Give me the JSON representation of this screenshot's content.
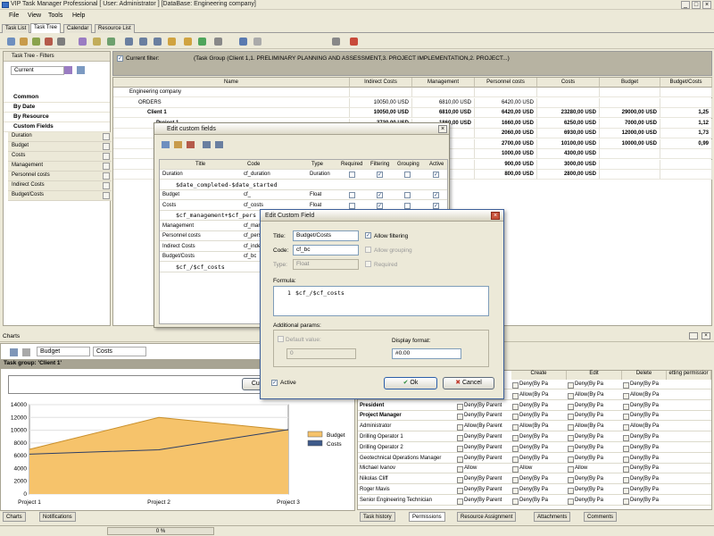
{
  "window": {
    "title": "VIP Task Manager Professional [ User: Administrator ] [DataBase: Engineering company]"
  },
  "menu": [
    "File",
    "View",
    "Tools",
    "Help"
  ],
  "tabs": [
    "Task List",
    "Task Tree",
    "Calendar",
    "Resource List"
  ],
  "filters": {
    "title": "Task Tree - Filters",
    "current": "Current",
    "groups": [
      "Common",
      "By Date",
      "By Resource",
      "Custom Fields"
    ],
    "fields": [
      "Duration",
      "Budget",
      "Costs",
      "Management",
      "Personnel costs",
      "Indirect Costs",
      "Budget/Costs"
    ]
  },
  "current_filter": {
    "label": "Current filter:",
    "text": "(Task Group  (Client 1,1. PRELIMINARY PLANNING AND ASSESSMENT,3. PROJECT IMPLEMENTATION,2. PROJECT...)"
  },
  "grid": {
    "headers": [
      "Name",
      "Indirect Costs",
      "Management",
      "Personnel costs",
      "Costs",
      "Budget",
      "Budget/Costs"
    ],
    "rows": [
      {
        "name": "Engineering company",
        "v": [
          "",
          "",
          "",
          "",
          "",
          ""
        ]
      },
      {
        "name": "ORDERS",
        "v": [
          "10050,00 USD",
          "6810,00 USD",
          "6420,00 USD",
          "",
          "",
          ""
        ]
      },
      {
        "name": "Client 1",
        "v": [
          "10050,00 USD",
          "6810,00 USD",
          "6420,00 USD",
          "23280,00 USD",
          "29000,00 USD",
          "1,25"
        ]
      },
      {
        "name": "Project 1",
        "v": [
          "3730,00 USD",
          "1860,00 USD",
          "1660,00 USD",
          "6250,00 USD",
          "7000,00 USD",
          "1,12"
        ]
      },
      {
        "name": "",
        "v": [
          "",
          "",
          "2060,00 USD",
          "6930,00 USD",
          "12000,00 USD",
          "1,73"
        ]
      },
      {
        "name": "",
        "v": [
          "",
          "",
          "2700,00 USD",
          "10100,00 USD",
          "10000,00 USD",
          "0,99"
        ]
      },
      {
        "name": "",
        "v": [
          "",
          "",
          "1000,00 USD",
          "4300,00 USD",
          "",
          ""
        ]
      },
      {
        "name": "",
        "v": [
          "",
          "",
          "900,00 USD",
          "3000,00 USD",
          "",
          ""
        ]
      },
      {
        "name": "",
        "v": [
          "",
          "",
          "800,00 USD",
          "2800,00 USD",
          "",
          ""
        ]
      }
    ]
  },
  "edit_fields": {
    "title": "Edit custom fields",
    "headers": [
      "Title",
      "Code",
      "Type",
      "Required",
      "Filtering",
      "Grouping",
      "Active"
    ],
    "rows": [
      {
        "title": "Duration",
        "code": "cf_duration",
        "type": "Duration"
      },
      {
        "formula": "$date_completed-$date_started"
      },
      {
        "title": "Budget",
        "code": "cf_",
        "type": "Float"
      },
      {
        "title": "Costs",
        "code": "cf_costs",
        "type": "Float"
      },
      {
        "formula": "$cf_management+$cf_pers"
      },
      {
        "title": "Management",
        "code": "cf_man",
        "type": ""
      },
      {
        "title": "Personnel costs",
        "code": "cf_pers",
        "type": ""
      },
      {
        "title": "Indirect Costs",
        "code": "cf_inde",
        "type": ""
      },
      {
        "title": "Budget/Costs",
        "code": "cf_bc",
        "type": ""
      },
      {
        "formula": "$cf_/$cf_costs"
      }
    ]
  },
  "edit_field": {
    "title": "Edit Custom Field",
    "title_label": "Title:",
    "title_value": "Budget/Costs",
    "code_label": "Code:",
    "code_value": "cf_bc",
    "type_label": "Type:",
    "type_value": "Float",
    "allow_filtering": "Allow filtering",
    "allow_grouping": "Allow grouping",
    "required": "Required",
    "formula_label": "Formula:",
    "formula_line": "1",
    "formula": "$cf_/$cf_costs",
    "params_label": "Additional params:",
    "default_label": "Default value:",
    "default_value": "0",
    "display_label": "Display format:",
    "display_value": "#0.00",
    "active": "Active",
    "ok": "Ok",
    "cancel": "Cancel"
  },
  "charts": {
    "title": "Charts",
    "sel1": "Budget",
    "sel2": "Costs",
    "group": "Task group: 'Client 1'",
    "custom_btn": "Custo",
    "legend": [
      "Budget",
      "Costs"
    ],
    "tabs": [
      "Charts",
      "Notifications"
    ]
  },
  "chart_data": {
    "type": "area",
    "categories": [
      "Project 1",
      "Project 2",
      "Project 3"
    ],
    "series": [
      {
        "name": "Budget",
        "values": [
          7000,
          12000,
          10000
        ]
      },
      {
        "name": "Costs",
        "values": [
          6250,
          6930,
          10100
        ]
      }
    ],
    "ylim": [
      0,
      14000
    ],
    "yticks": [
      0,
      2000,
      4000,
      6000,
      8000,
      10000,
      12000,
      14000
    ],
    "legend_position": "right",
    "colors": {
      "Budget": "#f6c36b",
      "Costs": "#3e5a8a"
    }
  },
  "permissions": {
    "headers": [
      "Create",
      "Edit",
      "Delete",
      "etting permissior"
    ],
    "rows": [
      {
        "name": "",
        "c": [
          "Deny(By Parent",
          "Deny(By Pa",
          "Deny(By Pa",
          "Deny(By Pa"
        ]
      },
      {
        "name": "",
        "c": [
          "Allow(By Parent",
          "Allow(By Pa",
          "Allow(By Pa",
          "Allow(By Pa"
        ]
      },
      {
        "name": "President",
        "c": [
          "Deny(By Parent",
          "Deny(By Pa",
          "Deny(By Pa",
          "Deny(By Pa"
        ]
      },
      {
        "name": "Project Manager",
        "c": [
          "Deny(By Parent",
          "Deny(By Pa",
          "Deny(By Pa",
          "Deny(By Pa"
        ]
      },
      {
        "name": "Administrator",
        "c": [
          "Allow(By Parent",
          "Allow(By Pa",
          "Allow(By Pa",
          "Allow(By Pa"
        ]
      },
      {
        "name": "Drilling Operator 1",
        "c": [
          "Deny(By Parent",
          "Deny(By Pa",
          "Deny(By Pa",
          "Deny(By Pa"
        ]
      },
      {
        "name": "Drilling Operator 2",
        "c": [
          "Deny(By Parent",
          "Deny(By Pa",
          "Deny(By Pa",
          "Deny(By Pa"
        ]
      },
      {
        "name": "Geotechnical Operations Manager",
        "c": [
          "Deny(By Parent",
          "Deny(By Pa",
          "Deny(By Pa",
          "Deny(By Pa"
        ]
      },
      {
        "name": "Michael Ivanov",
        "c": [
          "Allow",
          "Allow",
          "Allow",
          "Deny(By Pa"
        ]
      },
      {
        "name": "Nikolas Cliff",
        "c": [
          "Deny(By Parent",
          "Deny(By Pa",
          "Deny(By Pa",
          "Deny(By Pa"
        ]
      },
      {
        "name": "Roger Mavis",
        "c": [
          "Deny(By Parent",
          "Deny(By Pa",
          "Deny(By Pa",
          "Deny(By Pa"
        ]
      },
      {
        "name": "Senior Engineering Technician",
        "c": [
          "Deny(By Parent",
          "Deny(By Pa",
          "Deny(By Pa",
          "Deny(By Pa"
        ]
      }
    ],
    "tabs": [
      "Task history",
      "Permissions",
      "Resource Assignment",
      "Attachments",
      "Comments"
    ]
  },
  "status": {
    "progress": "0 %"
  }
}
